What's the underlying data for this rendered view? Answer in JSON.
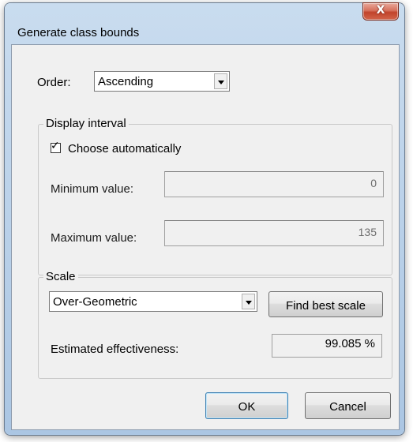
{
  "window": {
    "title": "Generate class bounds",
    "close_glyph": "X"
  },
  "order": {
    "label": "Order:",
    "selected": "Ascending"
  },
  "display_interval": {
    "legend": "Display interval",
    "choose_automatically_label": "Choose automatically",
    "choose_automatically_checked": true,
    "min_label": "Minimum value:",
    "min_value": "0",
    "max_label": "Maximum value:",
    "max_value": "135"
  },
  "scale": {
    "legend": "Scale",
    "selected": "Over-Geometric",
    "find_best_label": "Find best scale",
    "effectiveness_label": "Estimated effectiveness:",
    "effectiveness_value": "99.085 %"
  },
  "buttons": {
    "ok": "OK",
    "cancel": "Cancel"
  },
  "icons": {
    "close": "close-icon",
    "dropdown": "chevron-down-icon",
    "check": "checkmark-icon"
  }
}
